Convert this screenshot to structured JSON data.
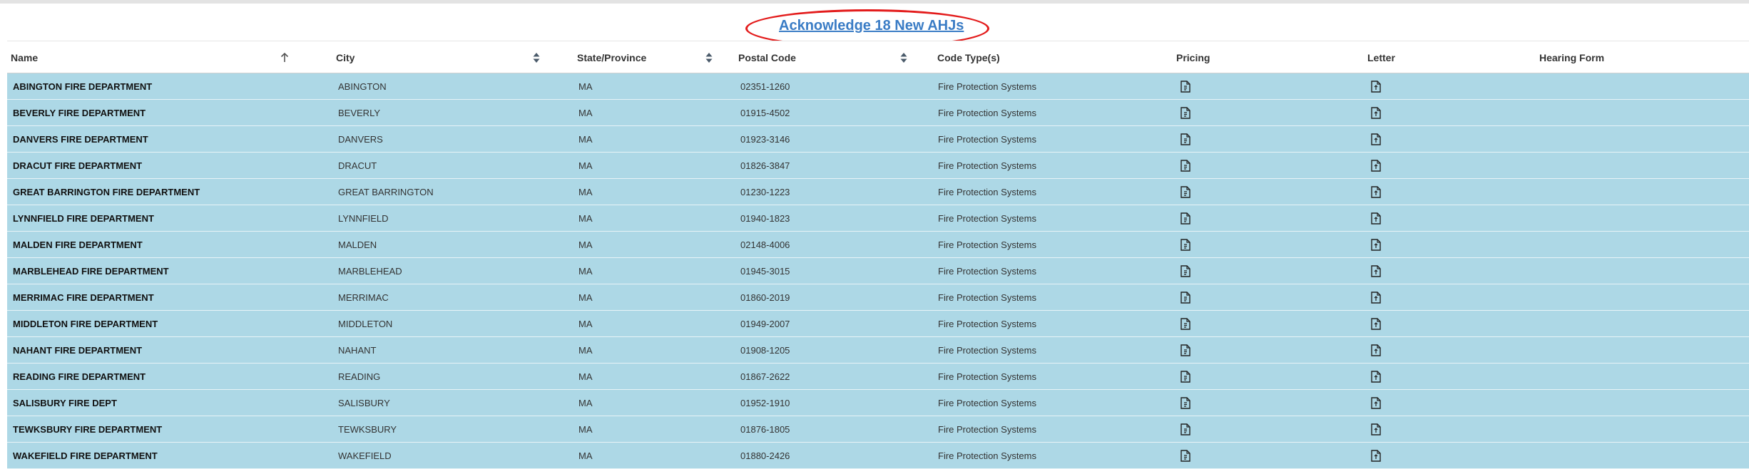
{
  "acknowledge": {
    "label": "Acknowledge 18 New AHJs"
  },
  "columns": {
    "name": "Name",
    "city": "City",
    "state": "State/Province",
    "postal": "Postal Code",
    "code": "Code Type(s)",
    "pricing": "Pricing",
    "letter": "Letter",
    "hearing": "Hearing Form"
  },
  "icons": {
    "sort_asc": "arrow-up-icon",
    "sort_both": "sort-icon",
    "document": "document-icon"
  },
  "colors": {
    "row_background": "#add8e6",
    "link": "#3a7cc5",
    "highlight_oval": "#e31b1b"
  },
  "rows": [
    {
      "name": "ABINGTON FIRE DEPARTMENT",
      "city": "ABINGTON",
      "state": "MA",
      "postal": "02351-1260",
      "code": "Fire Protection Systems"
    },
    {
      "name": "BEVERLY FIRE DEPARTMENT",
      "city": "BEVERLY",
      "state": "MA",
      "postal": "01915-4502",
      "code": "Fire Protection Systems"
    },
    {
      "name": "DANVERS FIRE DEPARTMENT",
      "city": "DANVERS",
      "state": "MA",
      "postal": "01923-3146",
      "code": "Fire Protection Systems"
    },
    {
      "name": "DRACUT FIRE DEPARTMENT",
      "city": "DRACUT",
      "state": "MA",
      "postal": "01826-3847",
      "code": "Fire Protection Systems"
    },
    {
      "name": "GREAT BARRINGTON FIRE DEPARTMENT",
      "city": "GREAT BARRINGTON",
      "state": "MA",
      "postal": "01230-1223",
      "code": "Fire Protection Systems"
    },
    {
      "name": "LYNNFIELD FIRE DEPARTMENT",
      "city": "LYNNFIELD",
      "state": "MA",
      "postal": "01940-1823",
      "code": "Fire Protection Systems"
    },
    {
      "name": "MALDEN FIRE DEPARTMENT",
      "city": "MALDEN",
      "state": "MA",
      "postal": "02148-4006",
      "code": "Fire Protection Systems"
    },
    {
      "name": "MARBLEHEAD FIRE DEPARTMENT",
      "city": "MARBLEHEAD",
      "state": "MA",
      "postal": "01945-3015",
      "code": "Fire Protection Systems"
    },
    {
      "name": "MERRIMAC FIRE DEPARTMENT",
      "city": "MERRIMAC",
      "state": "MA",
      "postal": "01860-2019",
      "code": "Fire Protection Systems"
    },
    {
      "name": "MIDDLETON FIRE DEPARTMENT",
      "city": "MIDDLETON",
      "state": "MA",
      "postal": "01949-2007",
      "code": "Fire Protection Systems"
    },
    {
      "name": "NAHANT FIRE DEPARTMENT",
      "city": "NAHANT",
      "state": "MA",
      "postal": "01908-1205",
      "code": "Fire Protection Systems"
    },
    {
      "name": "READING FIRE DEPARTMENT",
      "city": "READING",
      "state": "MA",
      "postal": "01867-2622",
      "code": "Fire Protection Systems"
    },
    {
      "name": "SALISBURY FIRE DEPT",
      "city": "SALISBURY",
      "state": "MA",
      "postal": "01952-1910",
      "code": "Fire Protection Systems"
    },
    {
      "name": "TEWKSBURY FIRE DEPARTMENT",
      "city": "TEWKSBURY",
      "state": "MA",
      "postal": "01876-1805",
      "code": "Fire Protection Systems"
    },
    {
      "name": "WAKEFIELD FIRE DEPARTMENT",
      "city": "WAKEFIELD",
      "state": "MA",
      "postal": "01880-2426",
      "code": "Fire Protection Systems"
    }
  ]
}
